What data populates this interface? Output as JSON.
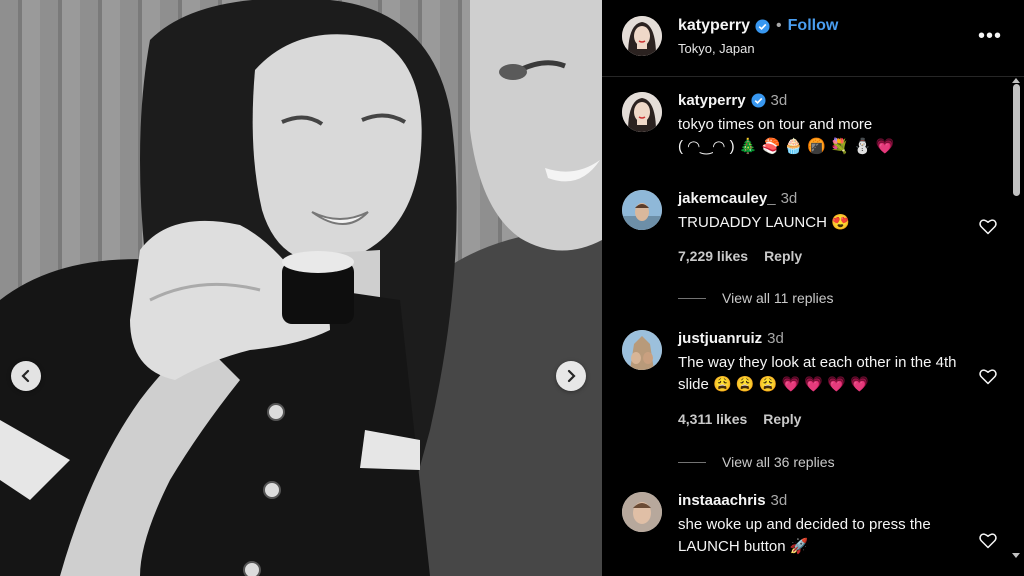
{
  "photo": {
    "prev_button_icon": "chevron-left-icon",
    "next_button_icon": "chevron-right-icon"
  },
  "header": {
    "username": "katyperry",
    "verified_icon": "verified-badge-icon",
    "separator": "•",
    "follow_label": "Follow",
    "location": "Tokyo, Japan",
    "more_icon": "more-options-icon",
    "more_glyph": "•••"
  },
  "caption": {
    "username": "katyperry",
    "time": "3d",
    "text_line1": "tokyo times on tour and more",
    "text_line2": "( ◠‿◠ ) 🎄 🍣 🧁 🍘 💐 ⛄ 💗"
  },
  "comments": [
    {
      "username": "jakemcauley_",
      "time": "3d",
      "text": "TRUDADDY LAUNCH 😍",
      "likes": "7,229 likes",
      "reply_label": "Reply",
      "view_replies": "View all 11 replies"
    },
    {
      "username": "justjuanruiz",
      "time": "3d",
      "text": "The way they look at each other in the 4th slide 😩 😩 😩 💗 💗 💗 💗",
      "likes": "4,311 likes",
      "reply_label": "Reply",
      "view_replies": "View all 36 replies"
    },
    {
      "username": "instaaachris",
      "time": "3d",
      "text": "she woke up and decided to press the LAUNCH button 🚀"
    }
  ],
  "colors": {
    "accent": "#4a9ef0",
    "panel_bg": "#000000",
    "verified": "#3897f0"
  }
}
